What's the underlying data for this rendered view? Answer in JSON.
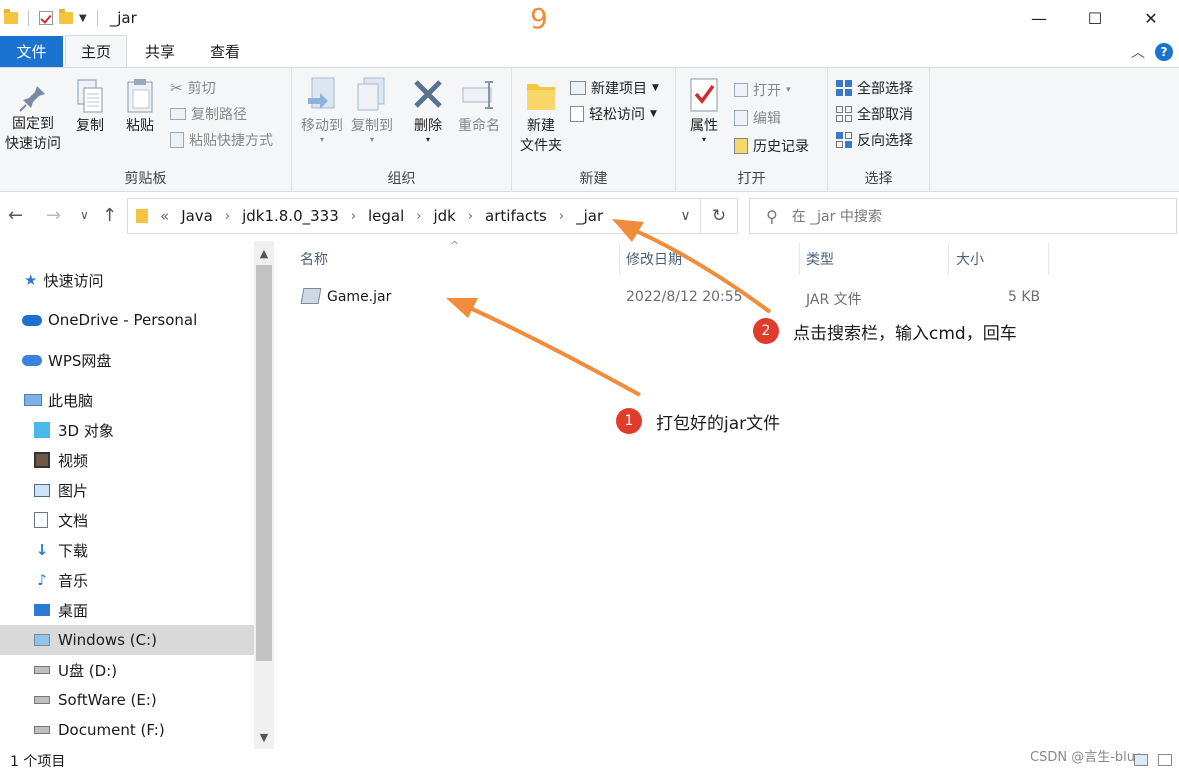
{
  "titlebar": {
    "title": "_jar",
    "annotation_number": "9",
    "minimize": "—",
    "maximize": "☐",
    "close": "✕"
  },
  "tabs": [
    {
      "label": "文件"
    },
    {
      "label": "主页"
    },
    {
      "label": "共享"
    },
    {
      "label": "查看"
    }
  ],
  "ribbon": {
    "clipboard": {
      "label": "剪贴板",
      "pin": [
        "固定到",
        "快速访问"
      ],
      "copy": "复制",
      "paste": "粘贴",
      "cut": "剪切",
      "copy_path": "复制路径",
      "paste_shortcut": "粘贴快捷方式"
    },
    "organize": {
      "label": "组织",
      "move_to": "移动到",
      "copy_to": "复制到",
      "delete": "删除",
      "rename": "重命名"
    },
    "new": {
      "label": "新建",
      "new_folder": [
        "新建",
        "文件夹"
      ],
      "new_item": "新建项目",
      "easy_access": "轻松访问"
    },
    "open": {
      "label": "打开",
      "properties": "属性",
      "open": "打开",
      "edit": "编辑",
      "history": "历史记录"
    },
    "select": {
      "label": "选择",
      "select_all": "全部选择",
      "select_none": "全部取消",
      "invert": "反向选择"
    }
  },
  "address": {
    "prefix": "«",
    "crumbs": [
      "Java",
      "jdk1.8.0_333",
      "legal",
      "jdk",
      "artifacts",
      "_jar"
    ],
    "search_placeholder": "在 _jar 中搜索"
  },
  "nav": {
    "quick_access": "快速访问",
    "onedrive": "OneDrive - Personal",
    "wps": "WPS网盘",
    "this_pc": "此电脑",
    "items": [
      {
        "label": "3D 对象"
      },
      {
        "label": "视频"
      },
      {
        "label": "图片"
      },
      {
        "label": "文档"
      },
      {
        "label": "下载"
      },
      {
        "label": "音乐"
      },
      {
        "label": "桌面"
      },
      {
        "label": "Windows (C:)"
      },
      {
        "label": "U盘 (D:)"
      },
      {
        "label": "SoftWare (E:)"
      },
      {
        "label": "Document (F:)"
      }
    ]
  },
  "columns": {
    "name": "名称",
    "date": "修改日期",
    "type": "类型",
    "size": "大小"
  },
  "files": [
    {
      "name": "Game.jar",
      "date": "2022/8/12 20:55",
      "type": "JAR 文件",
      "size": "5 KB"
    }
  ],
  "status": {
    "count": "1 个项目"
  },
  "watermark": "CSDN @言生-blue",
  "annotations": [
    {
      "num": "1",
      "text": "打包好的jar文件"
    },
    {
      "num": "2",
      "text": "点击搜索栏，输入cmd，回车"
    }
  ],
  "colors": {
    "file_tab": "#1a73d0",
    "arrow": "#f08c3a",
    "badge": "#e03c2b"
  }
}
